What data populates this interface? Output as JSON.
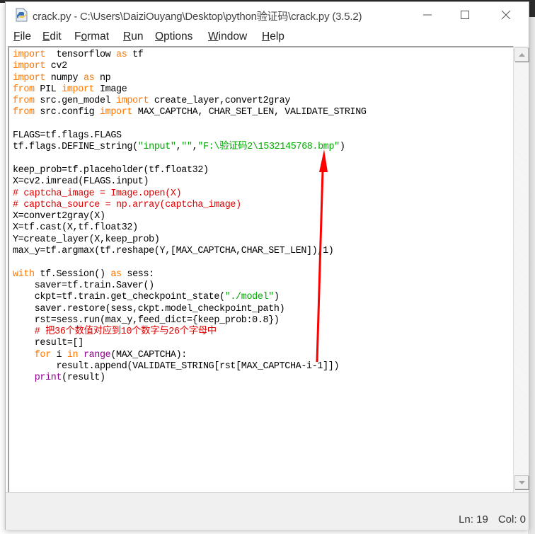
{
  "window": {
    "title": "crack.py - C:\\Users\\DaiziOuyang\\Desktop\\python验证码\\crack.py (3.5.2)",
    "app_icon": "python-file-icon",
    "controls": {
      "minimize": "minimize-icon",
      "maximize": "maximize-icon",
      "close": "close-icon"
    }
  },
  "menu": [
    {
      "pre": "",
      "key": "F",
      "post": "ile"
    },
    {
      "pre": "",
      "key": "E",
      "post": "dit"
    },
    {
      "pre": "F",
      "key": "o",
      "post": "rmat"
    },
    {
      "pre": "",
      "key": "R",
      "post": "un"
    },
    {
      "pre": "",
      "key": "O",
      "post": "ptions"
    },
    {
      "pre": "",
      "key": "W",
      "post": "indow"
    },
    {
      "pre": "",
      "key": "H",
      "post": "elp"
    }
  ],
  "editor": {
    "lines": [
      [
        [
          "kw",
          "import"
        ],
        [
          "",
          "  tensorflow "
        ],
        [
          "kw",
          "as"
        ],
        [
          "",
          " tf"
        ]
      ],
      [
        [
          "kw",
          "import"
        ],
        [
          "",
          " cv2"
        ]
      ],
      [
        [
          "kw",
          "import"
        ],
        [
          "",
          " numpy "
        ],
        [
          "kw",
          "as"
        ],
        [
          "",
          " np"
        ]
      ],
      [
        [
          "kw",
          "from"
        ],
        [
          "",
          " PIL "
        ],
        [
          "kw",
          "import"
        ],
        [
          "",
          " Image"
        ]
      ],
      [
        [
          "kw",
          "from"
        ],
        [
          "",
          " src.gen_model "
        ],
        [
          "kw",
          "import"
        ],
        [
          "",
          " create_layer,convert2gray"
        ]
      ],
      [
        [
          "kw",
          "from"
        ],
        [
          "",
          " src.config "
        ],
        [
          "kw",
          "import"
        ],
        [
          "",
          " MAX_CAPTCHA, CHAR_SET_LEN, VALIDATE_STRING"
        ]
      ],
      [
        [
          "",
          ""
        ]
      ],
      [
        [
          "",
          "FLAGS=tf.flags.FLAGS"
        ]
      ],
      [
        [
          "",
          "tf.flags.DEFINE_string("
        ],
        [
          "str",
          "\"input\""
        ],
        [
          "",
          ","
        ],
        [
          "str",
          "\"\""
        ],
        [
          "",
          ","
        ],
        [
          "str",
          "\"F:\\验证码2\\1532145768.bmp\""
        ],
        [
          "",
          ")"
        ]
      ],
      [
        [
          "",
          ""
        ]
      ],
      [
        [
          "",
          "keep_prob=tf.placeholder(tf.float32)"
        ]
      ],
      [
        [
          "",
          "X=cv2.imread(FLAGS.input)"
        ]
      ],
      [
        [
          "cmt",
          "# captcha_image = Image.open(X)"
        ]
      ],
      [
        [
          "cmt",
          "# captcha_source = np.array(captcha_image)"
        ]
      ],
      [
        [
          "",
          "X=convert2gray(X)"
        ]
      ],
      [
        [
          "",
          "X=tf.cast(X,tf.float32)"
        ]
      ],
      [
        [
          "",
          "Y=create_layer(X,keep_prob)"
        ]
      ],
      [
        [
          "",
          "max_y=tf.argmax(tf.reshape(Y,[MAX_CAPTCHA,CHAR_SET_LEN]),1)"
        ]
      ],
      [
        [
          "",
          ""
        ]
      ],
      [
        [
          "kw",
          "with"
        ],
        [
          "",
          " tf.Session() "
        ],
        [
          "kw",
          "as"
        ],
        [
          "",
          " sess:"
        ]
      ],
      [
        [
          "",
          "    saver=tf.train.Saver()"
        ]
      ],
      [
        [
          "",
          "    ckpt=tf.train.get_checkpoint_state("
        ],
        [
          "str",
          "\"./model\""
        ],
        [
          "",
          ")"
        ]
      ],
      [
        [
          "",
          "    saver.restore(sess,ckpt.model_checkpoint_path)"
        ]
      ],
      [
        [
          "",
          "    rst=sess.run(max_y,feed_dict={keep_prob:0.8})"
        ]
      ],
      [
        [
          "cmt",
          "    # 把36个数值对应到10个数字与26个字母中"
        ]
      ],
      [
        [
          "",
          "    result=[]"
        ]
      ],
      [
        [
          "kw",
          "    for"
        ],
        [
          "",
          " i "
        ],
        [
          "kw",
          "in"
        ],
        [
          "",
          " "
        ],
        [
          "bi",
          "range"
        ],
        [
          "",
          "(MAX_CAPTCHA):"
        ]
      ],
      [
        [
          "",
          "        result.append(VALIDATE_STRING[rst[MAX_CAPTCHA-i-1]])"
        ]
      ],
      [
        [
          "bi",
          "    print"
        ],
        [
          "",
          "(result)"
        ]
      ]
    ]
  },
  "scrollbar": {
    "up": "scroll-up-arrow-icon",
    "down": "scroll-down-arrow-icon"
  },
  "status": {
    "line": "Ln: 19",
    "col": "Col: 0"
  },
  "annotation": {
    "type": "red-arrow-icon",
    "color": "#ff0000"
  },
  "colors": {
    "keyword": "#ff7700",
    "string": "#00aa00",
    "comment": "#dd0000",
    "builtin": "#900090"
  }
}
